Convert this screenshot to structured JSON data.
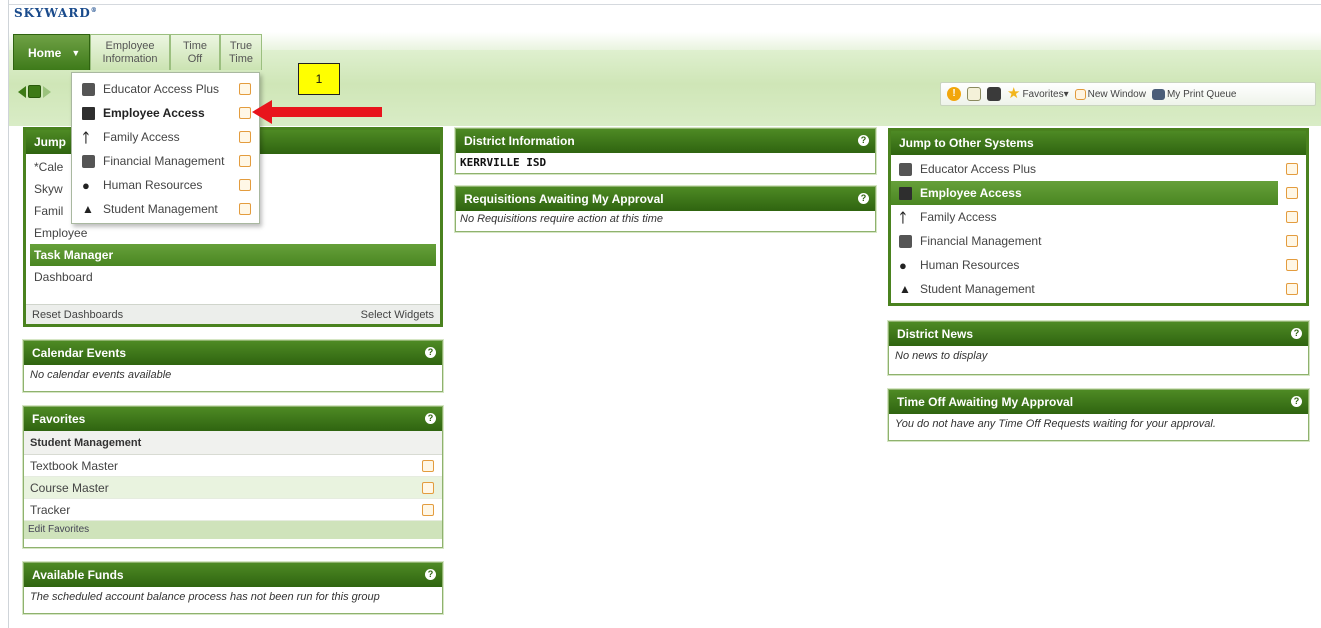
{
  "logo": "SKYWARD",
  "nav": {
    "home": "Home",
    "tabs": [
      "Employee Information",
      "Time Off",
      "True Time"
    ]
  },
  "dropdown": {
    "items": [
      {
        "label": "Educator Access Plus",
        "icon": "calculator-icon"
      },
      {
        "label": "Employee Access",
        "icon": "briefcase-icon",
        "active": true
      },
      {
        "label": "Family Access",
        "icon": "family-icon"
      },
      {
        "label": "Financial Management",
        "icon": "calculator-icon"
      },
      {
        "label": "Human Resources",
        "icon": "person-icon"
      },
      {
        "label": "Student Management",
        "icon": "graduation-cap-icon"
      }
    ]
  },
  "annotation": {
    "number": "1",
    "arrow_color": "#e8141c",
    "box_color": "#ffff00"
  },
  "toolbar": {
    "favorites": "Favorites▾",
    "new_window": "New Window",
    "print_queue": "My Print Queue"
  },
  "jump_panel": {
    "title": "Jump",
    "rows": [
      "*Cale",
      "Skyw",
      "Famil",
      "Employee",
      "Task Manager",
      "Dashboard"
    ],
    "selected": "Task Manager",
    "footer_left": "Reset Dashboards",
    "footer_right": "Select Widgets"
  },
  "calendar": {
    "title": "Calendar Events",
    "message": "No calendar events available"
  },
  "favorites": {
    "title": "Favorites",
    "group": "Student Management",
    "items": [
      "Textbook Master",
      "Course Master",
      "Tracker"
    ],
    "footer": "Edit Favorites"
  },
  "funds": {
    "title": "Available Funds",
    "message": "The scheduled account balance process has not been run for this group"
  },
  "district_info": {
    "title": "District Information",
    "name": "KERRVILLE ISD"
  },
  "requisitions": {
    "title": "Requisitions Awaiting My Approval",
    "message": "No Requisitions require action at this time"
  },
  "other_systems": {
    "title": "Jump to Other Systems",
    "items": [
      "Educator Access Plus",
      "Employee Access",
      "Family Access",
      "Financial Management",
      "Human Resources",
      "Student Management"
    ],
    "selected": "Employee Access"
  },
  "news": {
    "title": "District News",
    "message": "No news to display"
  },
  "timeoff": {
    "title": "Time Off Awaiting My Approval",
    "message": "You do not have any Time Off Requests waiting for your approval."
  },
  "colors": {
    "header_green": "#3f7a18",
    "band_green": "#d3e8bd",
    "accent_orange": "#e39c3e"
  }
}
